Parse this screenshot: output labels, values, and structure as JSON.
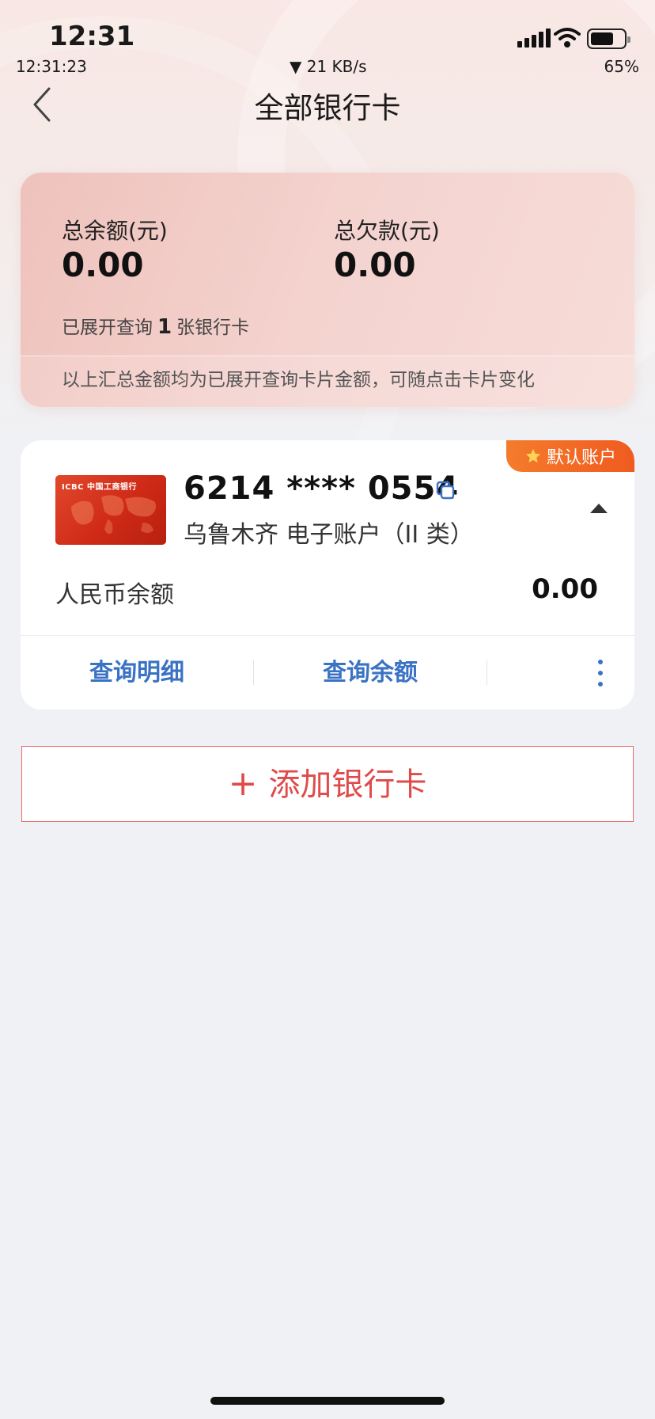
{
  "status_bar": {
    "time": "12:31",
    "clock_detail": "12:31:23",
    "network_speed": "▼ 21 KB/s",
    "battery_percent": "65%"
  },
  "nav": {
    "title": "全部银行卡"
  },
  "summary": {
    "total_balance_label": "总余额(元)",
    "total_balance_value": "0.00",
    "total_debt_label": "总欠款(元)",
    "total_debt_value": "0.00",
    "expanded_prefix": "已展开查询",
    "expanded_count": "1",
    "expanded_suffix": "张银行卡",
    "footnote": "以上汇总金额均为已展开查询卡片金额，可随点击卡片变化"
  },
  "account": {
    "default_badge": "默认账户",
    "card_logo": "ICBC 中国工商银行",
    "card_number": "6214 **** 0554",
    "card_description": "乌鲁木齐 电子账户（II 类）",
    "rmb_balance_label": "人民币余额",
    "rmb_balance_value": "0.00",
    "actions": {
      "detail": "查询明细",
      "balance": "查询余额"
    }
  },
  "add_card": {
    "plus": "+",
    "label": "添加银行卡"
  },
  "colors": {
    "brand_red": "#e04a4a",
    "action_blue": "#3a72c4",
    "badge_orange": "#f26a26"
  }
}
